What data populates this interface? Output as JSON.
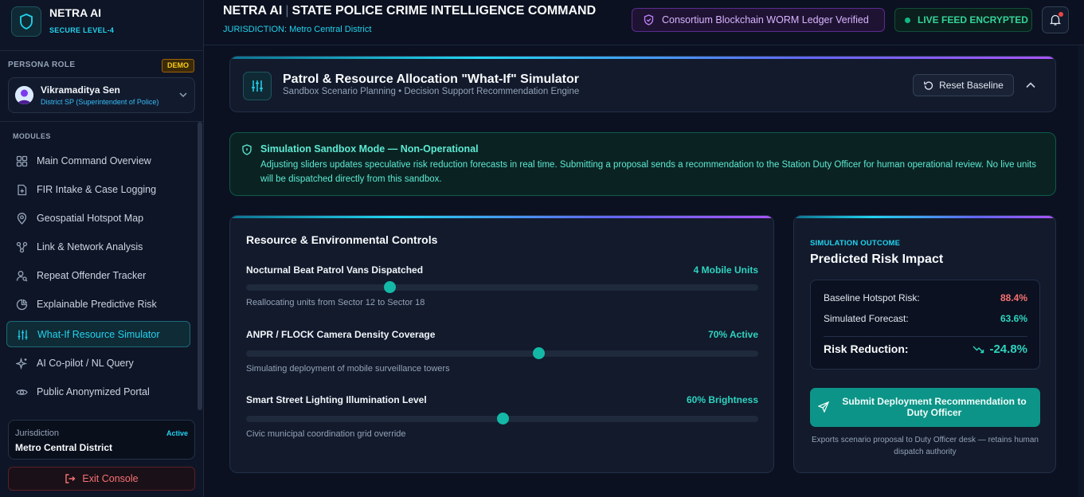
{
  "brand": {
    "name": "NETRA AI",
    "security": "SECURE LEVEL-4"
  },
  "persona": {
    "label": "PERSONA ROLE",
    "badge": "DEMO",
    "name": "Vikramaditya Sen",
    "role": "District SP (Superintendent of Police)"
  },
  "nav": {
    "label": "MODULES",
    "items": [
      {
        "label": "Main Command Overview",
        "icon": "grid-icon"
      },
      {
        "label": "FIR Intake & Case Logging",
        "icon": "file-plus-icon"
      },
      {
        "label": "Geospatial Hotspot Map",
        "icon": "map-pin-icon"
      },
      {
        "label": "Link & Network Analysis",
        "icon": "network-icon"
      },
      {
        "label": "Repeat Offender Tracker",
        "icon": "user-search-icon"
      },
      {
        "label": "Explainable Predictive Risk",
        "icon": "chart-icon"
      },
      {
        "label": "What-If Resource Simulator",
        "icon": "sliders-icon",
        "active": true
      },
      {
        "label": "AI Co-pilot / NL Query",
        "icon": "sparkles-icon"
      },
      {
        "label": "Public Anonymized Portal",
        "icon": "eye-icon"
      }
    ]
  },
  "jurisdiction": {
    "label": "Jurisdiction",
    "value": "Metro Central District",
    "status": "Active"
  },
  "exit_label": "Exit Console",
  "header": {
    "title_left": "NETRA AI",
    "title_right": "STATE POLICE CRIME INTELLIGENCE COMMAND",
    "subtitle": "JURISDICTION: Metro Central District",
    "ledger": "Consortium Blockchain WORM Ledger Verified",
    "live": "LIVE FEED ENCRYPTED"
  },
  "simulator": {
    "title": "Patrol & Resource Allocation \"What-If\" Simulator",
    "subtitle": "Sandbox Scenario Planning • Decision Support Recommendation Engine",
    "reset_label": "Reset Baseline"
  },
  "notice": {
    "title": "Simulation Sandbox Mode — Non-Operational",
    "text": "Adjusting sliders updates speculative risk reduction forecasts in real time. Submitting a proposal sends a recommendation to the Station Duty Officer for human operational review. No live units will be dispatched directly from this sandbox."
  },
  "controls": {
    "title": "Resource & Environmental Controls",
    "sliders": [
      {
        "label": "Nocturnal Beat Patrol Vans Dispatched",
        "value_text": "4 Mobile Units",
        "hint": "Reallocating units from Sector 12 to Sector 18",
        "fraction": 0.28
      },
      {
        "label": "ANPR / FLOCK Camera Density Coverage",
        "value_text": "70% Active",
        "hint": "Simulating deployment of mobile surveillance towers",
        "fraction": 0.57
      },
      {
        "label": "Smart Street Lighting Illumination Level",
        "value_text": "60% Brightness",
        "hint": "Civic municipal coordination grid override",
        "fraction": 0.5
      }
    ]
  },
  "outcome": {
    "label": "SIMULATION OUTCOME",
    "title": "Predicted Risk Impact",
    "baseline_label": "Baseline Hotspot Risk:",
    "baseline_value": "88.4%",
    "forecast_label": "Simulated Forecast:",
    "forecast_value": "63.6%",
    "reduction_label": "Risk Reduction:",
    "reduction_value": "-24.8%",
    "submit_label": "Submit Deployment Recommendation to Duty Officer",
    "note": "Exports scenario proposal to Duty Officer desk — retains human dispatch authority"
  },
  "colors": {
    "accent": "#22d3ee",
    "teal": "#14b8a6",
    "danger": "#f87171",
    "success": "#2dd4bf",
    "purple": "#a855f7"
  }
}
